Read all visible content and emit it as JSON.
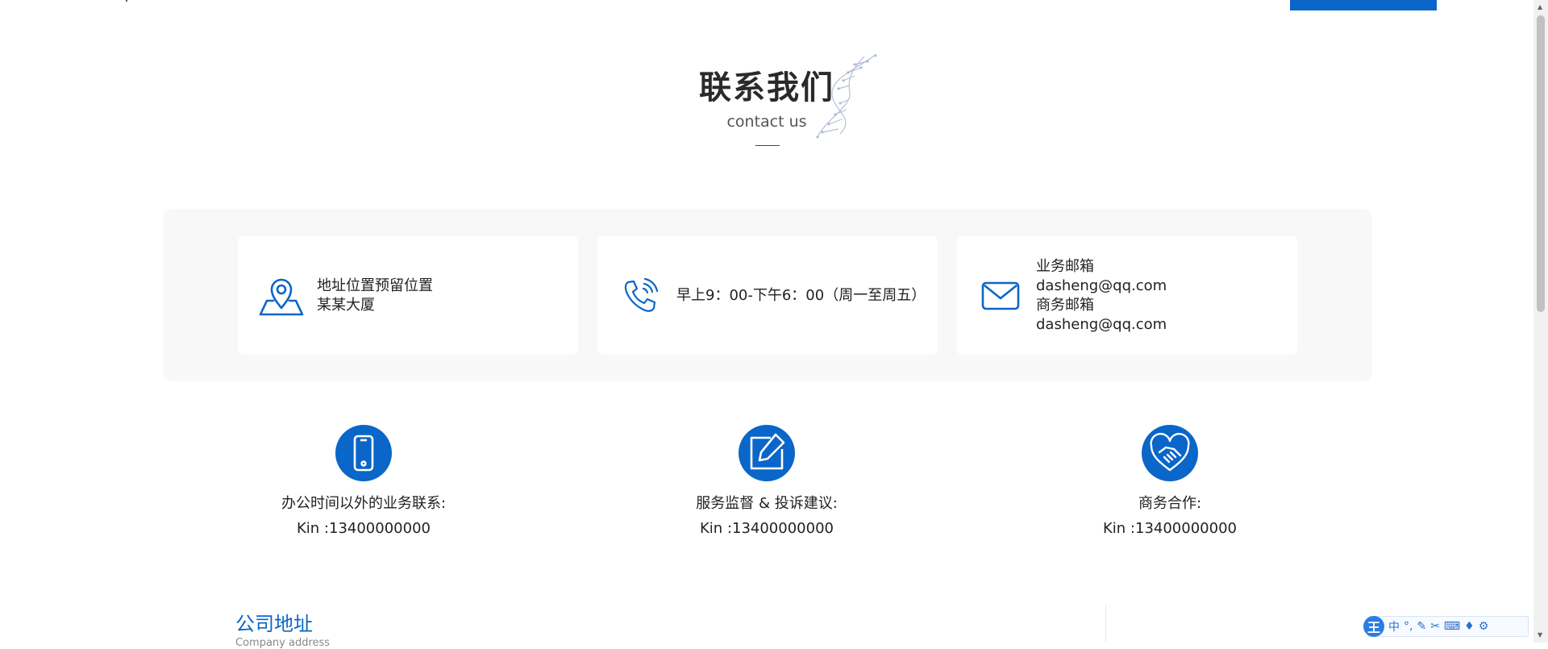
{
  "header": {
    "title": "联系我们",
    "subtitle": "contact us"
  },
  "info_cards": [
    {
      "icon": "location-map-icon",
      "lines": [
        "地址位置预留位置",
        "某某大厦"
      ]
    },
    {
      "icon": "phone-call-icon",
      "lines": [
        "早上9：00-下午6：00（周一至周五）"
      ]
    },
    {
      "icon": "mail-icon",
      "lines": [
        "业务邮箱",
        "dasheng@qq.com",
        "商务邮箱",
        "dasheng@qq.com"
      ]
    }
  ],
  "features": [
    {
      "icon": "mobile-phone-icon",
      "title": "办公时间以外的业务联系:",
      "value": "Kin :13400000000"
    },
    {
      "icon": "edit-icon",
      "title": "服务监督 & 投诉建议:",
      "value": "Kin :13400000000"
    },
    {
      "icon": "handshake-heart-icon",
      "title": "商务合作:",
      "value": "Kin :13400000000"
    }
  ],
  "address_section": {
    "title": "公司地址",
    "subtitle": "Company address"
  },
  "ime_toolbar": {
    "logo": "王",
    "mode": "中",
    "items": [
      "punctuation-icon",
      "pen-icon",
      "scissors-icon",
      "keyboard-icon",
      "skin-icon",
      "settings-icon"
    ]
  },
  "colors": {
    "accent": "#0a66c8",
    "panel_bg": "#f8f8f8"
  }
}
